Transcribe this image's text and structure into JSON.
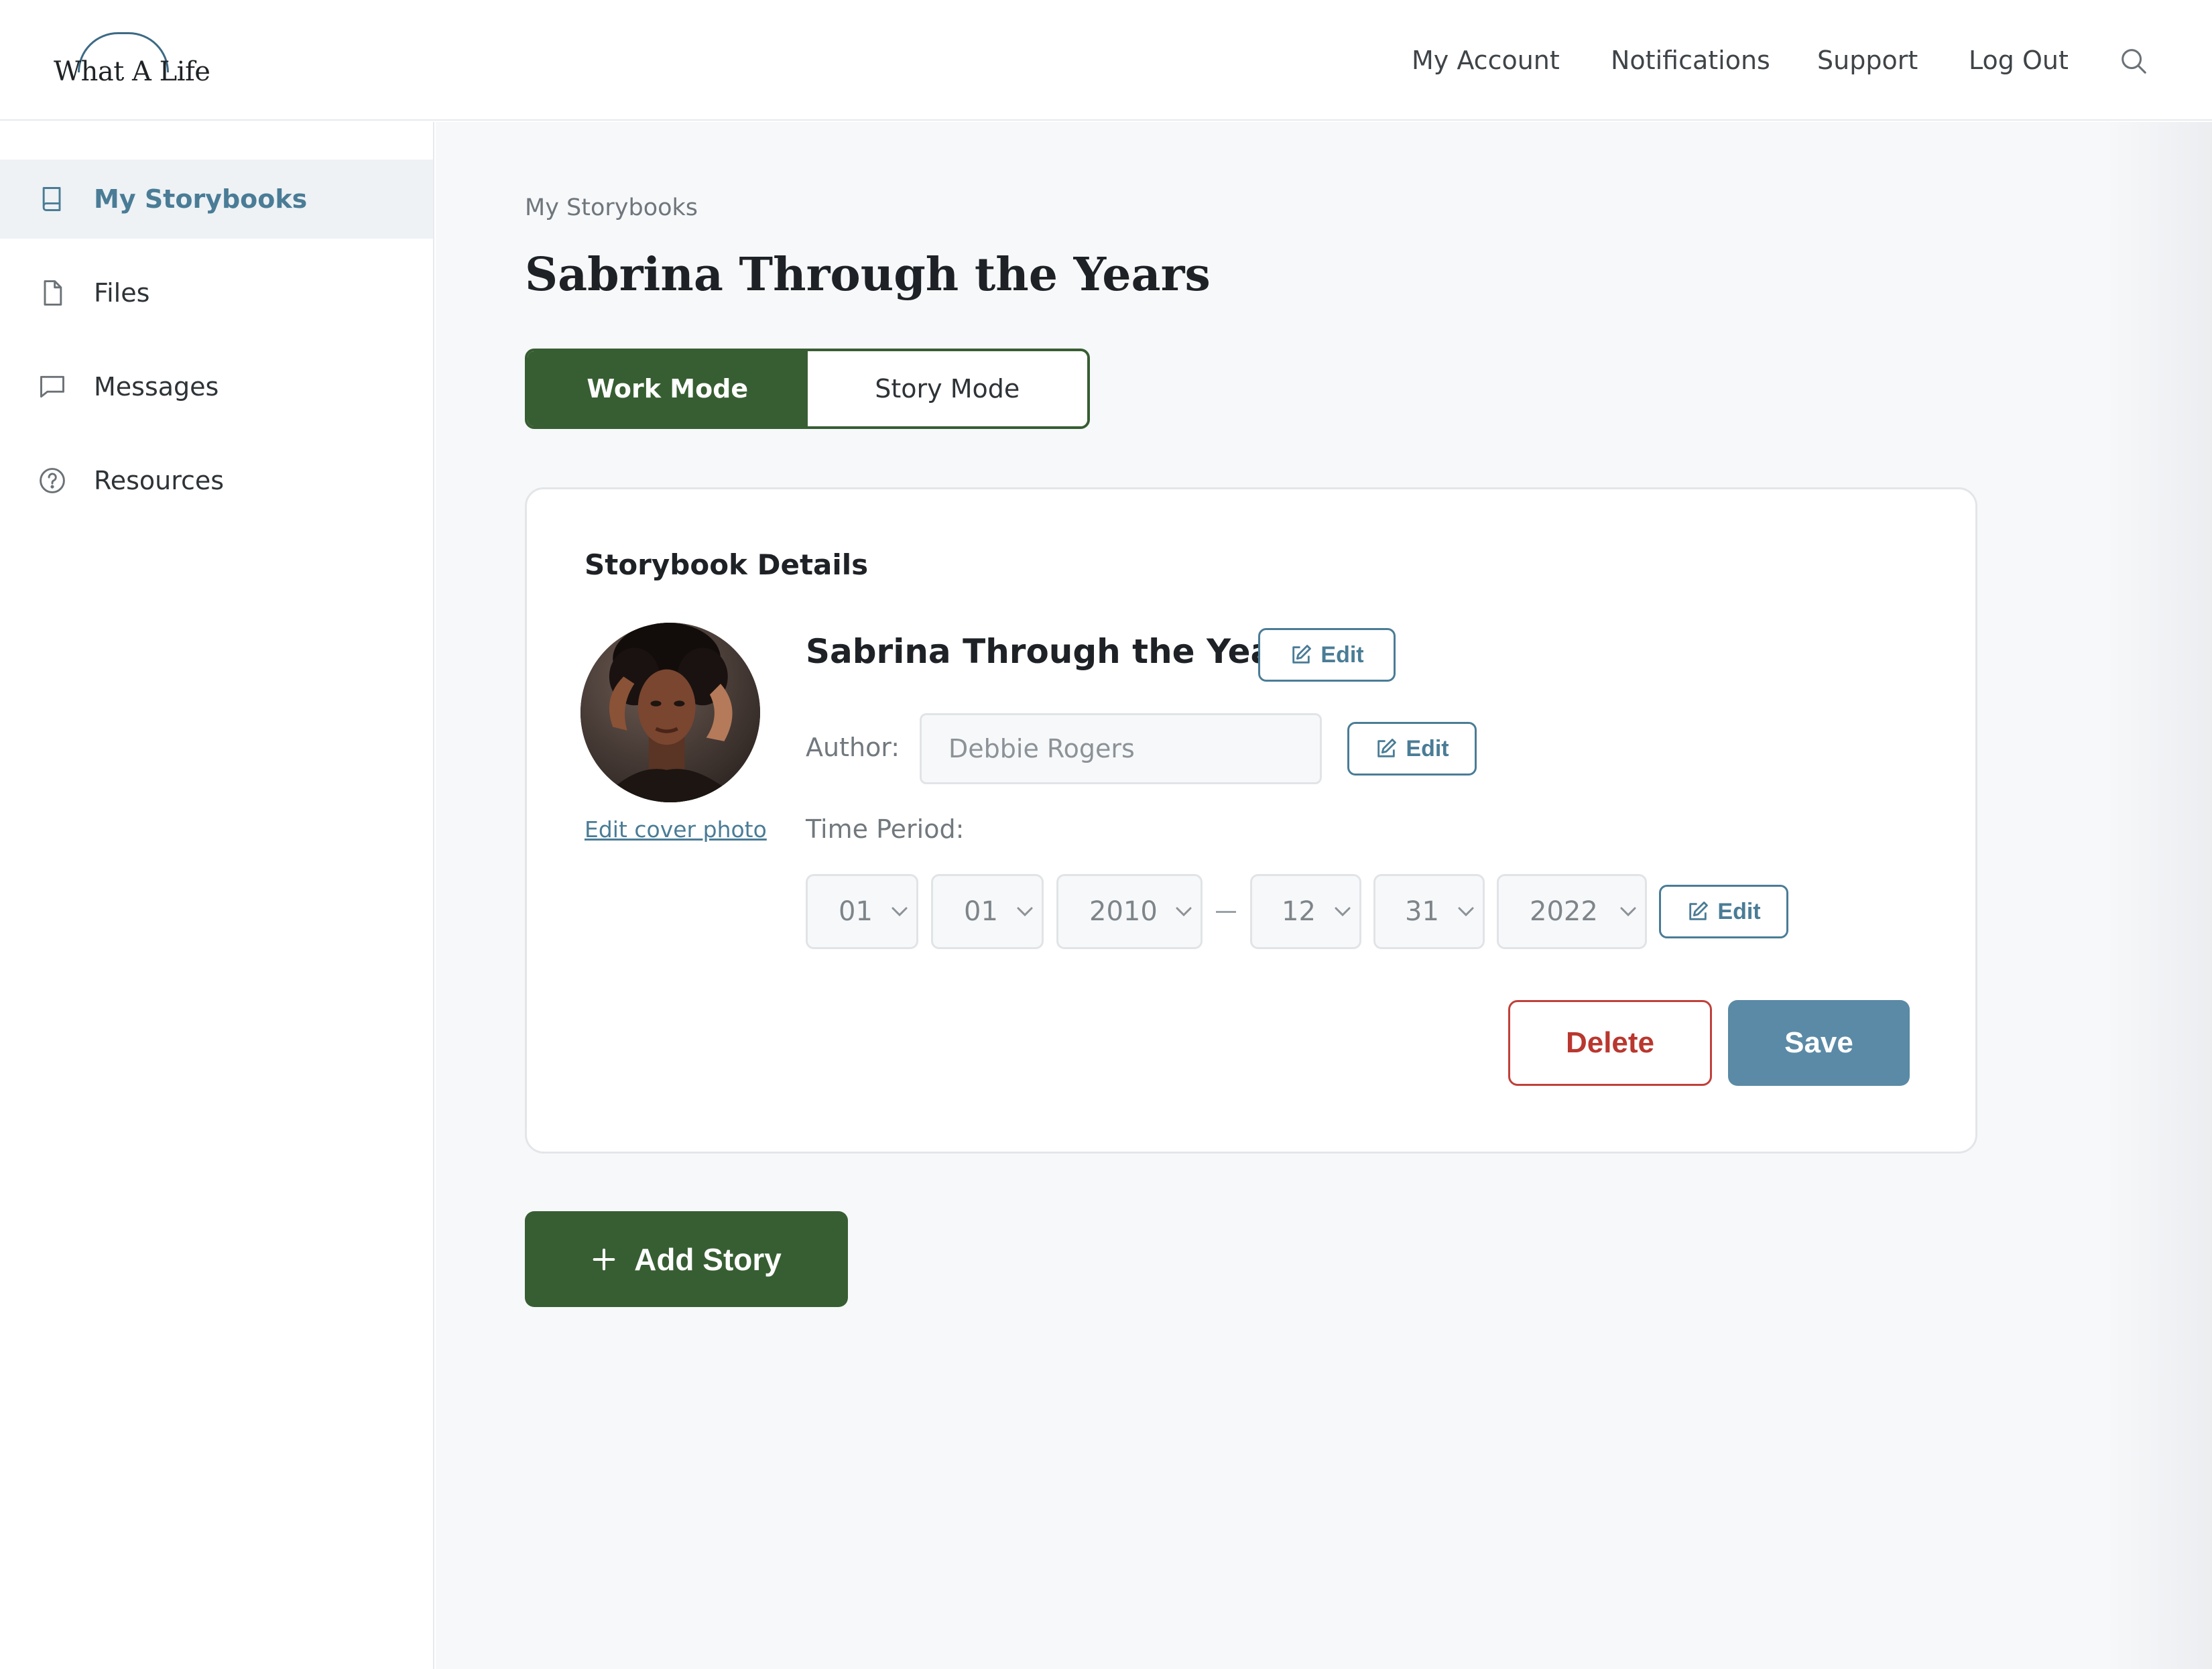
{
  "brand": {
    "name": "What A Life"
  },
  "header": {
    "nav": [
      {
        "label": "My Account",
        "icon": "user-account"
      },
      {
        "label": "Notifications",
        "icon": "bell"
      },
      {
        "label": "Support",
        "icon": "help"
      },
      {
        "label": "Log Out",
        "icon": "logout"
      }
    ],
    "search_icon": "search-icon"
  },
  "sidebar": {
    "items": [
      {
        "label": "My Storybooks",
        "icon": "book-icon",
        "active": true
      },
      {
        "label": "Files",
        "icon": "file-icon",
        "active": false
      },
      {
        "label": "Messages",
        "icon": "message-icon",
        "active": false
      },
      {
        "label": "Resources",
        "icon": "help-circle-icon",
        "active": false
      }
    ]
  },
  "main": {
    "breadcrumb": "My Storybooks",
    "title": "Sabrina Through the Years",
    "modes": {
      "work": "Work Mode",
      "story": "Story Mode",
      "selected": "Work Mode"
    },
    "details": {
      "heading": "Storybook Details",
      "edit_cover_label": "Edit cover photo",
      "storybook_title": "Sabrina Through the Years",
      "edit_label": "Edit",
      "author_label": "Author:",
      "author_placeholder": "Debbie Rogers",
      "time_period_label": "Time Period:",
      "start": {
        "month": "01",
        "day": "01",
        "year": "2010"
      },
      "end": {
        "month": "12",
        "day": "31",
        "year": "2022"
      },
      "delete_label": "Delete",
      "save_label": "Save"
    },
    "add_story_label": "Add Story"
  },
  "colors": {
    "primary_green": "#375e32",
    "accent_blue": "#4a7c96",
    "save_blue": "#5a8aa6",
    "delete_red": "#b9372f",
    "background": "#f7f8fa"
  }
}
